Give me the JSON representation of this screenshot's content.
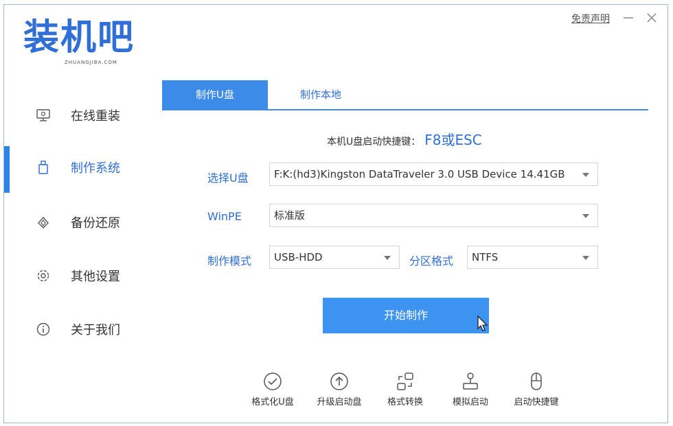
{
  "window": {
    "disclaimer": "免责声明",
    "min_icon": "minimize-icon",
    "close_icon": "close-icon"
  },
  "logo": {
    "main": "装机吧",
    "sub": "ZHUANGJIBA.COM"
  },
  "sidebar": {
    "items": [
      {
        "label": "在线重装",
        "icon": "monitor-icon",
        "active": false
      },
      {
        "label": "制作系统",
        "icon": "usb-drive-icon",
        "active": true
      },
      {
        "label": "备份还原",
        "icon": "backup-icon",
        "active": false
      },
      {
        "label": "其他设置",
        "icon": "gear-icon",
        "active": false
      },
      {
        "label": "关于我们",
        "icon": "info-icon",
        "active": false
      }
    ]
  },
  "tabs": [
    {
      "label": "制作U盘",
      "active": true
    },
    {
      "label": "制作本地",
      "active": false
    }
  ],
  "hotkey": {
    "label": "本机U盘启动快捷键：",
    "value": "F8或ESC"
  },
  "form": {
    "usb_label": "选择U盘",
    "usb_value": "F:K:(hd3)Kingston DataTraveler 3.0 USB Device 14.41GB",
    "winpe_label": "WinPE",
    "winpe_value": "标准版",
    "mode_label": "制作模式",
    "mode_value": "USB-HDD",
    "partition_label": "分区格式",
    "partition_value": "NTFS"
  },
  "start_button": "开始制作",
  "tools": [
    {
      "label": "格式化U盘",
      "icon": "check-circle-icon"
    },
    {
      "label": "升级启动盘",
      "icon": "upload-circle-icon"
    },
    {
      "label": "格式转换",
      "icon": "convert-icon"
    },
    {
      "label": "模拟启动",
      "icon": "joystick-icon"
    },
    {
      "label": "启动快捷键",
      "icon": "mouse-icon"
    }
  ],
  "colors": {
    "accent": "#3c8be8",
    "brand": "#2f6fd6",
    "button": "#3c93f0"
  }
}
